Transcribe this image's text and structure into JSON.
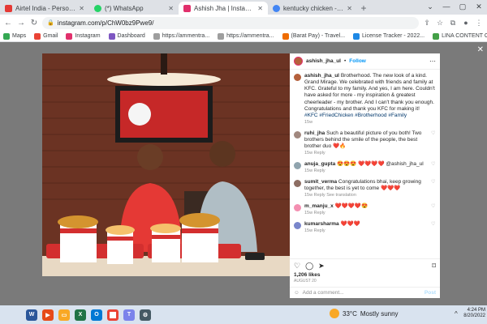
{
  "browser": {
    "tabs": [
      {
        "title": "Airtel India - Personal Bl",
        "color": "#e53935",
        "active": false
      },
      {
        "title": "(*) WhatsApp",
        "color": "#25d366",
        "active": false
      },
      {
        "title": "Ashish Jha | Instagram (@ashish_jha_ul)",
        "color": "#e1306c",
        "active": true
      },
      {
        "title": "kentucky chicken - Google Search",
        "color": "#4285f4",
        "active": false
      }
    ],
    "new_tab": "+",
    "url": "instagram.com/p/ChW0bz9Pwe9/",
    "bookmarks": [
      {
        "label": "Maps",
        "color": "#34a853"
      },
      {
        "label": "Gmail",
        "color": "#ea4335"
      },
      {
        "label": "Instagram",
        "color": "#e1306c"
      },
      {
        "label": "Dashboard",
        "color": "#7e57c2"
      },
      {
        "label": "https://ammentra...",
        "color": "#9e9e9e"
      },
      {
        "label": "https://ammentra...",
        "color": "#9e9e9e"
      },
      {
        "label": "(Barat Pay) - Travel...",
        "color": "#ef6c00"
      },
      {
        "label": "License Tracker - 2022...",
        "color": "#1e88e5"
      },
      {
        "label": "LINA CONTENT C...",
        "color": "#43a047"
      }
    ]
  },
  "post": {
    "username": "ashish_jha_ul",
    "follow_label": "Follow",
    "caption_user": "ashish_jha_ul",
    "caption_text": "Brotherhood. The new look of a kind. Grand Mirage. We celebrated with friends and family at KFC. Grateful to my family. And yes, I am here. Couldn't have asked for more - my inspiration & greatest cheerleader - my brother. And I can't thank you enough. Congratulations and thank you KFC for making it!",
    "caption_tags": "#KFC #FriedChicken #Brotherhood #Family",
    "caption_time": "15w",
    "comments": [
      {
        "user": "ruhi_jha",
        "text": "Such a beautiful picture of you both! Two brothers behind the smile of the people, the best brother duo ❤️🔥",
        "meta": "15w  Reply",
        "color": "#a1887f"
      },
      {
        "user": "anuja_gupta",
        "text": "😍😍😍 ❤️❤️❤️❤️ @ashish_jha_ul",
        "meta": "15w  Reply",
        "color": "#90a4ae"
      },
      {
        "user": "sumit_verma",
        "text": "Congratulations bhai, keep growing together, the best is yet to come ❤️❤️❤️",
        "meta": "15w  Reply  See translation",
        "color": "#8d6e63"
      },
      {
        "user": "m_manju_x",
        "text": "❤️❤️❤️❤️😍",
        "meta": "15w  Reply",
        "color": "#f48fb1"
      },
      {
        "user": "kumarsharma",
        "text": "❤️❤️❤️",
        "meta": "15w  Reply",
        "color": "#7986cb"
      }
    ],
    "likes": "1,206 likes",
    "date": "AUGUST 20",
    "add_comment_placeholder": "Add a comment...",
    "post_label": "Post"
  },
  "taskbar": {
    "weather_temp": "33°C",
    "weather_desc": "Mostly sunny",
    "time": "4:24 PM",
    "date": "8/20/2022"
  }
}
